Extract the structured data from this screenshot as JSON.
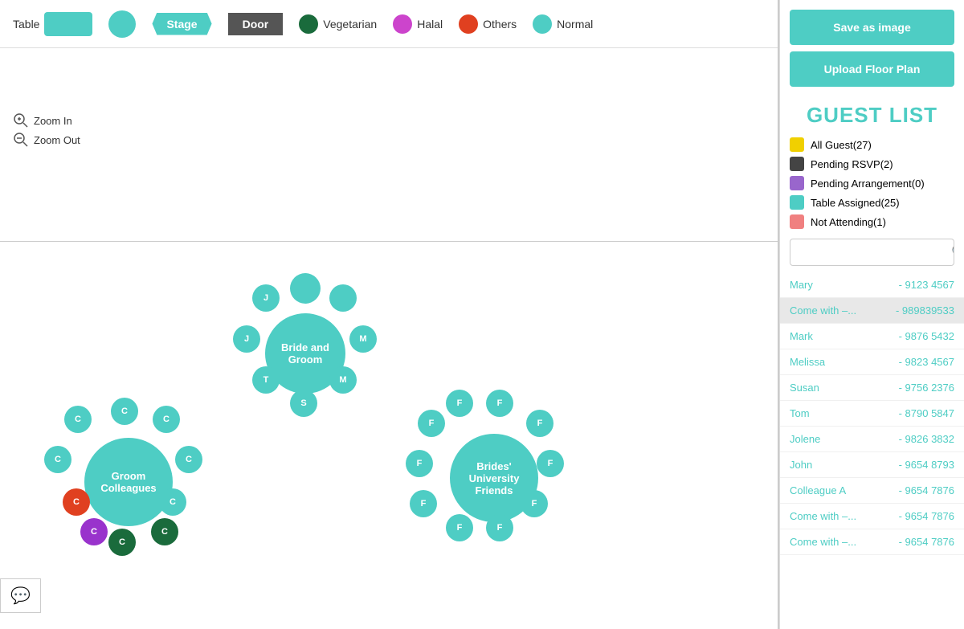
{
  "legend": {
    "table_label": "Table",
    "stage_label": "Stage",
    "door_label": "Door",
    "vegetarian_label": "Vegetarian",
    "halal_label": "Halal",
    "others_label": "Others",
    "normal_label": "Normal"
  },
  "zoom": {
    "zoom_in_label": "Zoom In",
    "zoom_out_label": "Zoom Out"
  },
  "actions": {
    "save_image_label": "Save as image",
    "upload_floor_label": "Upload Floor Plan"
  },
  "guest_list": {
    "title": "GUEST LIST",
    "filters": [
      {
        "label": "All Guest(27)",
        "color_class": "f-yellow"
      },
      {
        "label": "Pending RSVP(2)",
        "color_class": "f-dark"
      },
      {
        "label": "Pending Arrangement(0)",
        "color_class": "f-purple"
      },
      {
        "label": "Table Assigned(25)",
        "color_class": "f-teal"
      },
      {
        "label": "Not Attending(1)",
        "color_class": "f-pink"
      }
    ],
    "guests": [
      {
        "name": "Mary",
        "phone": "- 9123 4567"
      },
      {
        "name": "Come with –...",
        "phone": "- 989839533"
      },
      {
        "name": "Mark",
        "phone": "- 9876 5432"
      },
      {
        "name": "Melissa",
        "phone": "- 9823 4567"
      },
      {
        "name": "Susan",
        "phone": "- 9756 2376"
      },
      {
        "name": "Tom",
        "phone": "- 8790 5847"
      },
      {
        "name": "Jolene",
        "phone": "- 9826 3832"
      },
      {
        "name": "John",
        "phone": "- 9654 8793"
      },
      {
        "name": "Colleague A",
        "phone": "- 9654 7876"
      },
      {
        "name": "Come with –...",
        "phone": "- 9654 7876"
      },
      {
        "name": "Come with –...",
        "phone": "- 9654 7876"
      }
    ]
  },
  "tables": {
    "bride_groom": {
      "label": "Bride and\nGroom",
      "seats": [
        "J",
        "J",
        "T",
        "S",
        "M",
        "M"
      ]
    },
    "groom_colleagues": {
      "label": "Groom\nColleagues",
      "seats": [
        "C",
        "C",
        "C",
        "C",
        "C",
        "C",
        "C",
        "C"
      ]
    },
    "brides_university": {
      "label": "Brides'\nUniversity\nFriends",
      "seats": [
        "F",
        "F",
        "F",
        "F",
        "F",
        "F",
        "F",
        "F",
        "F",
        "F"
      ]
    }
  },
  "chat": {
    "icon": "💬"
  }
}
